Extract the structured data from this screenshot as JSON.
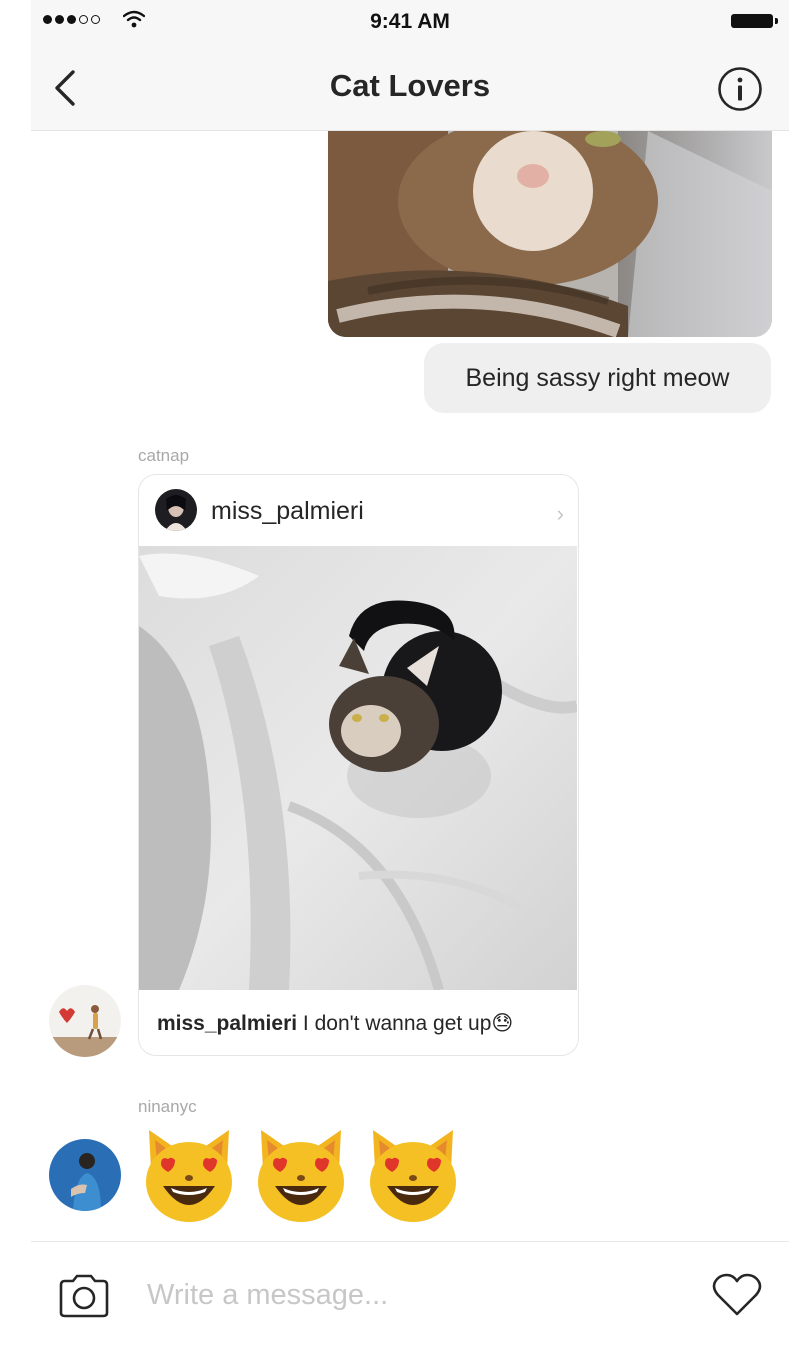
{
  "status_bar": {
    "time": "9:41 AM",
    "icons": [
      "signal-dots-icon",
      "wifi-icon",
      "battery-icon"
    ]
  },
  "header": {
    "title": "Cat Lovers",
    "back_icon": "chevron-left-icon",
    "info_icon": "info-circle-icon"
  },
  "messages": [
    {
      "type": "photo",
      "from": "me",
      "content": "photo of a cat lying on a couch"
    },
    {
      "type": "text",
      "from": "me",
      "text": "Being sassy right meow"
    },
    {
      "type": "shared_post",
      "sender": "catnap",
      "post": {
        "username": "miss_palmieri",
        "caption_user": "miss_palmieri",
        "caption_text": " I don't wanna get up",
        "caption_emoji": "😓"
      }
    },
    {
      "type": "emoji",
      "sender": "ninanyc",
      "emojis": [
        "😻",
        "😻",
        "😻"
      ]
    }
  ],
  "composer": {
    "placeholder": "Write a message...",
    "camera_icon": "camera-icon",
    "like_icon": "heart-icon"
  },
  "colors": {
    "bar_background": "#f7f7f7",
    "bubble": "#efefef",
    "muted_text": "#a8a8a8",
    "placeholder": "#c7c7c7"
  }
}
